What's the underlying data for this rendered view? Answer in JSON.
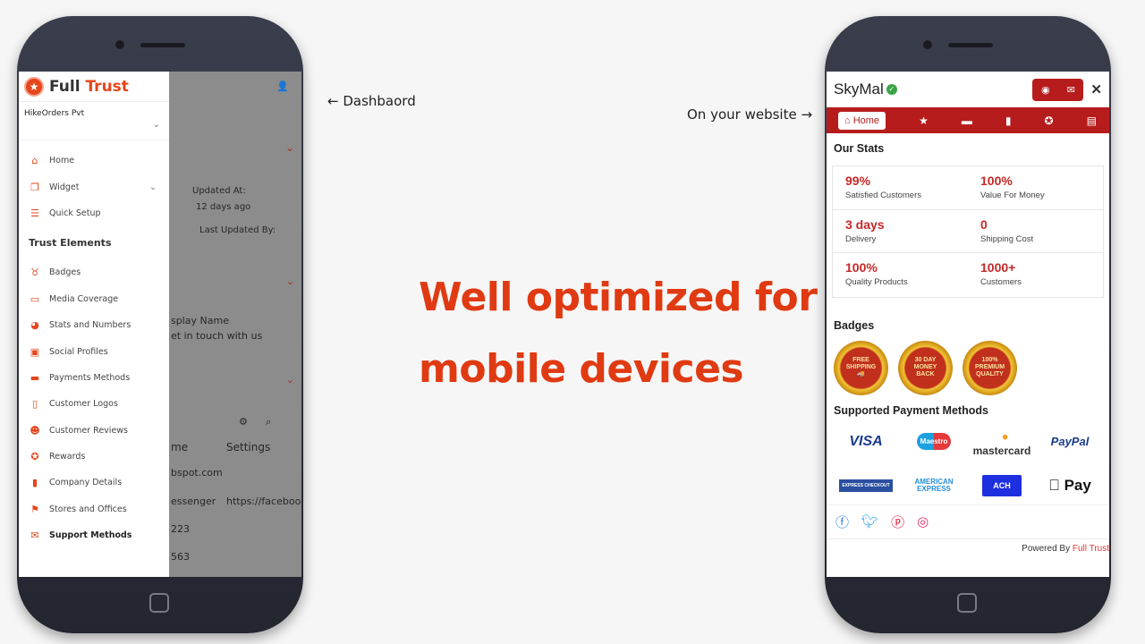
{
  "annotations": {
    "dashboard": "← Dashbaord",
    "website": "On your website →"
  },
  "headline": {
    "line1": "Well optimized for",
    "line2": "mobile devices"
  },
  "dashboard": {
    "logo": {
      "word1": "Full",
      "word2": "Trust"
    },
    "org": "HikeOrders Pvt",
    "menu": [
      {
        "label": "Home",
        "icon": "home-icon"
      },
      {
        "label": "Widget",
        "icon": "widget-icon"
      },
      {
        "label": "Quick Setup",
        "icon": "checklist-icon"
      }
    ],
    "section": "Trust Elements",
    "trust_items": [
      {
        "label": "Badges",
        "icon": "medal-icon"
      },
      {
        "label": "Media Coverage",
        "icon": "monitor-icon"
      },
      {
        "label": "Stats and Numbers",
        "icon": "pie-chart-icon"
      },
      {
        "label": "Social Profiles",
        "icon": "profile-icon"
      },
      {
        "label": "Payments Methods",
        "icon": "credit-card-icon"
      },
      {
        "label": "Customer Logos",
        "icon": "file-image-icon"
      },
      {
        "label": "Customer Reviews",
        "icon": "smile-icon"
      },
      {
        "label": "Rewards",
        "icon": "award-icon"
      },
      {
        "label": "Company Details",
        "icon": "building-icon"
      },
      {
        "label": "Stores and Offices",
        "icon": "map-icon"
      },
      {
        "label": "Support Methods",
        "icon": "envelope-icon"
      }
    ],
    "background": {
      "updated_at_label": "Updated At:",
      "updated_at": "12 days ago",
      "last_updated_by": "Last Updated By:",
      "display_name": "splay Name",
      "display_value": "et in touch with us",
      "col_name": "me",
      "col_settings": "Settings",
      "rows": [
        "bspot.com",
        "essenger",
        "223",
        "563"
      ],
      "row2_setting": "https://facebook"
    }
  },
  "widget": {
    "brand": "SkyMal",
    "nav_home": "Home",
    "stats_title": "Our Stats",
    "stats": [
      {
        "value": "99%",
        "label": "Satisfied Customers"
      },
      {
        "value": "100%",
        "label": "Value For Money"
      },
      {
        "value": "3 days",
        "label": "Delivery"
      },
      {
        "value": "0",
        "label": "Shipping Cost"
      },
      {
        "value": "100%",
        "label": "Quality Products"
      },
      {
        "value": "1000+",
        "label": "Customers"
      }
    ],
    "badges_title": "Badges",
    "badges": [
      [
        "FREE",
        "SHIPPING",
        "🚚"
      ],
      [
        "30 DAY",
        "MONEY",
        "BACK"
      ],
      [
        "100%",
        "PREMIUM",
        "QUALITY"
      ]
    ],
    "payments_title": "Supported Payment Methods",
    "payments": [
      "VISA",
      "Maestro",
      "mastercard",
      "PayPal",
      "EXPRESS CHECKOUT",
      "AMERICAN EXPRESS",
      "ACH",
      " Pay"
    ],
    "powered_by": "Powered By",
    "powered_brand": "Full Trust",
    "colors": {
      "primary": "#b71c1c",
      "accent": "#e03a12"
    }
  }
}
